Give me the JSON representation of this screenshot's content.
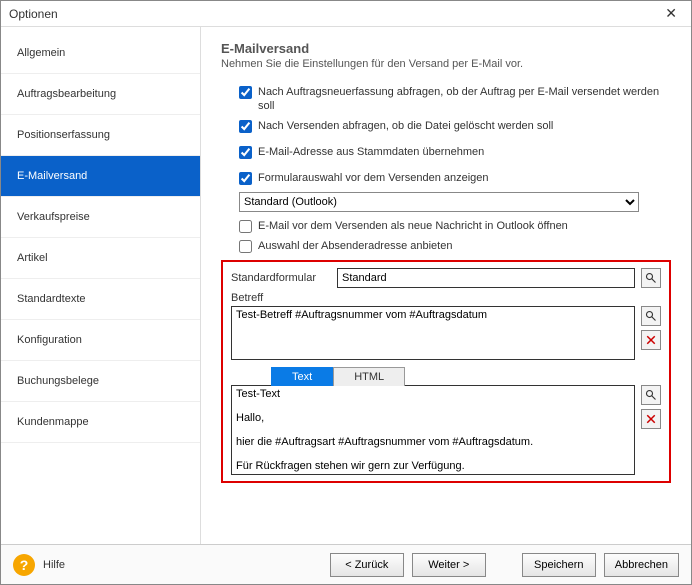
{
  "window": {
    "title": "Optionen"
  },
  "sidebar": {
    "items": [
      {
        "label": "Allgemein"
      },
      {
        "label": "Auftragsbearbeitung"
      },
      {
        "label": "Positionserfassung"
      },
      {
        "label": "E-Mailversand"
      },
      {
        "label": "Verkaufspreise"
      },
      {
        "label": "Artikel"
      },
      {
        "label": "Standardtexte"
      },
      {
        "label": "Konfiguration"
      },
      {
        "label": "Buchungsbelege"
      },
      {
        "label": "Kundenmappe"
      }
    ],
    "active_index": 3
  },
  "page": {
    "title": "E-Mailversand",
    "subtitle": "Nehmen Sie die Einstellungen für den Versand per E-Mail vor."
  },
  "opts": {
    "ask_after_create": "Nach Auftragsneuerfassung abfragen, ob der Auftrag per E-Mail versendet werden soll",
    "ask_delete_after_send": "Nach Versenden abfragen, ob die Datei gelöscht werden soll",
    "use_email_from_master": "E-Mail-Adresse aus Stammdaten übernehmen",
    "show_form_selection": "Formularauswahl vor dem Versenden anzeigen",
    "open_in_outlook": "E-Mail vor dem Versenden als neue Nachricht in Outlook öffnen",
    "offer_sender_choice": "Auswahl der Absenderadresse anbieten"
  },
  "mail_client": {
    "selected": "Standard (Outlook)"
  },
  "form": {
    "standard_form_label": "Standardformular",
    "standard_form_value": "Standard",
    "subject_label": "Betreff",
    "subject_value": "Test-Betreff #Auftragsnummer vom #Auftragsdatum",
    "tabs": {
      "text": "Text",
      "html": "HTML",
      "active": "text"
    },
    "body_text": "Test-Text\n\nHallo,\n\nhier die #Auftragsart #Auftragsnummer vom #Auftragsdatum.\n\nFür Rückfragen stehen wir gern zur Verfügung."
  },
  "footer": {
    "help": "Hilfe",
    "back": "< Zurück",
    "next": "Weiter >",
    "save": "Speichern",
    "cancel": "Abbrechen"
  }
}
